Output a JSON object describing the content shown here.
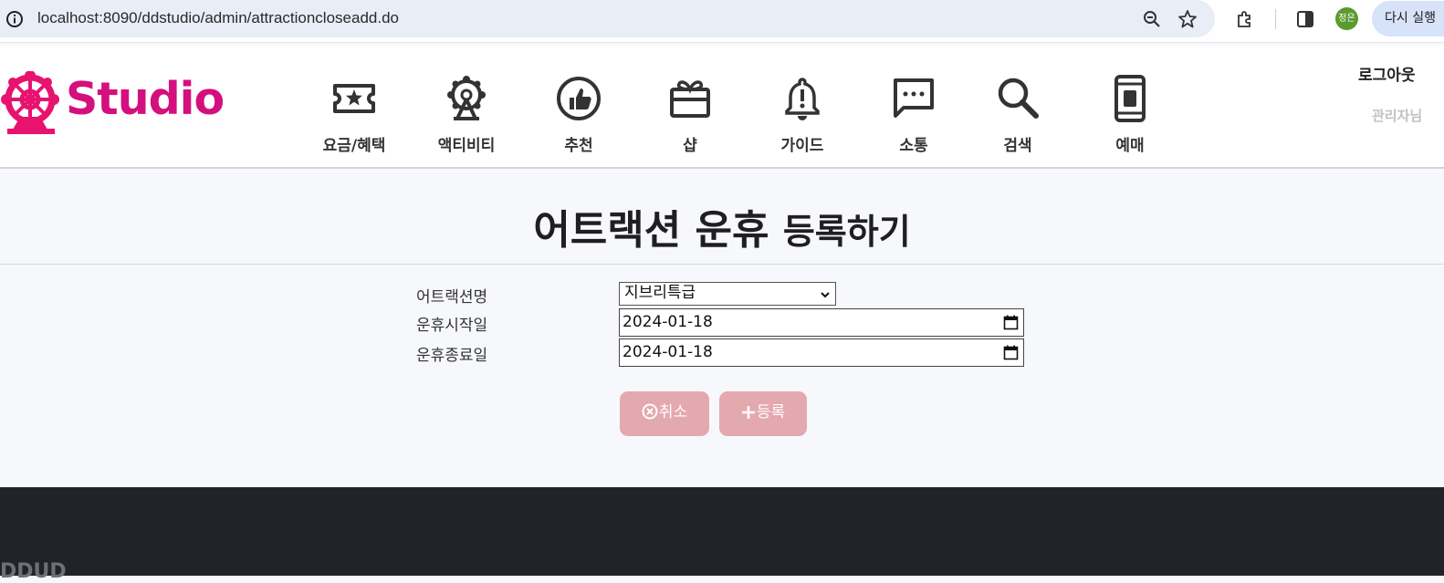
{
  "browser": {
    "url": "localhost:8090/ddstudio/admin/attractioncloseadd.do",
    "profile_initial": "정은",
    "relaunch_label": "다시 실행"
  },
  "header": {
    "logo_text": "Studio",
    "nav": [
      {
        "label": "요금/혜택",
        "icon": "ticket-icon"
      },
      {
        "label": "액티비티",
        "icon": "ferris-wheel-icon"
      },
      {
        "label": "추천",
        "icon": "thumbs-up-icon"
      },
      {
        "label": "샵",
        "icon": "gift-icon"
      },
      {
        "label": "가이드",
        "icon": "bell-icon"
      },
      {
        "label": "소통",
        "icon": "chat-icon"
      },
      {
        "label": "검색",
        "icon": "search-icon"
      },
      {
        "label": "예매",
        "icon": "mobile-ticket-icon"
      }
    ],
    "logout_label": "로그아웃",
    "admin_label": "관리자님"
  },
  "page": {
    "title_main": "어트랙션 운휴",
    "title_sub": "등록하기"
  },
  "form": {
    "attraction_label": "어트랙션명",
    "attraction_value": "지브리특급",
    "start_label": "운휴시작일",
    "start_value": "2024-01-18",
    "end_label": "운휴종료일",
    "end_value": "2024-01-18",
    "cancel_label": "취소",
    "submit_label": "등록"
  },
  "footer": {
    "text": "DDUD"
  },
  "colors": {
    "brand": "#d40f7e",
    "button": "#e4a8af",
    "footer": "#222328"
  }
}
